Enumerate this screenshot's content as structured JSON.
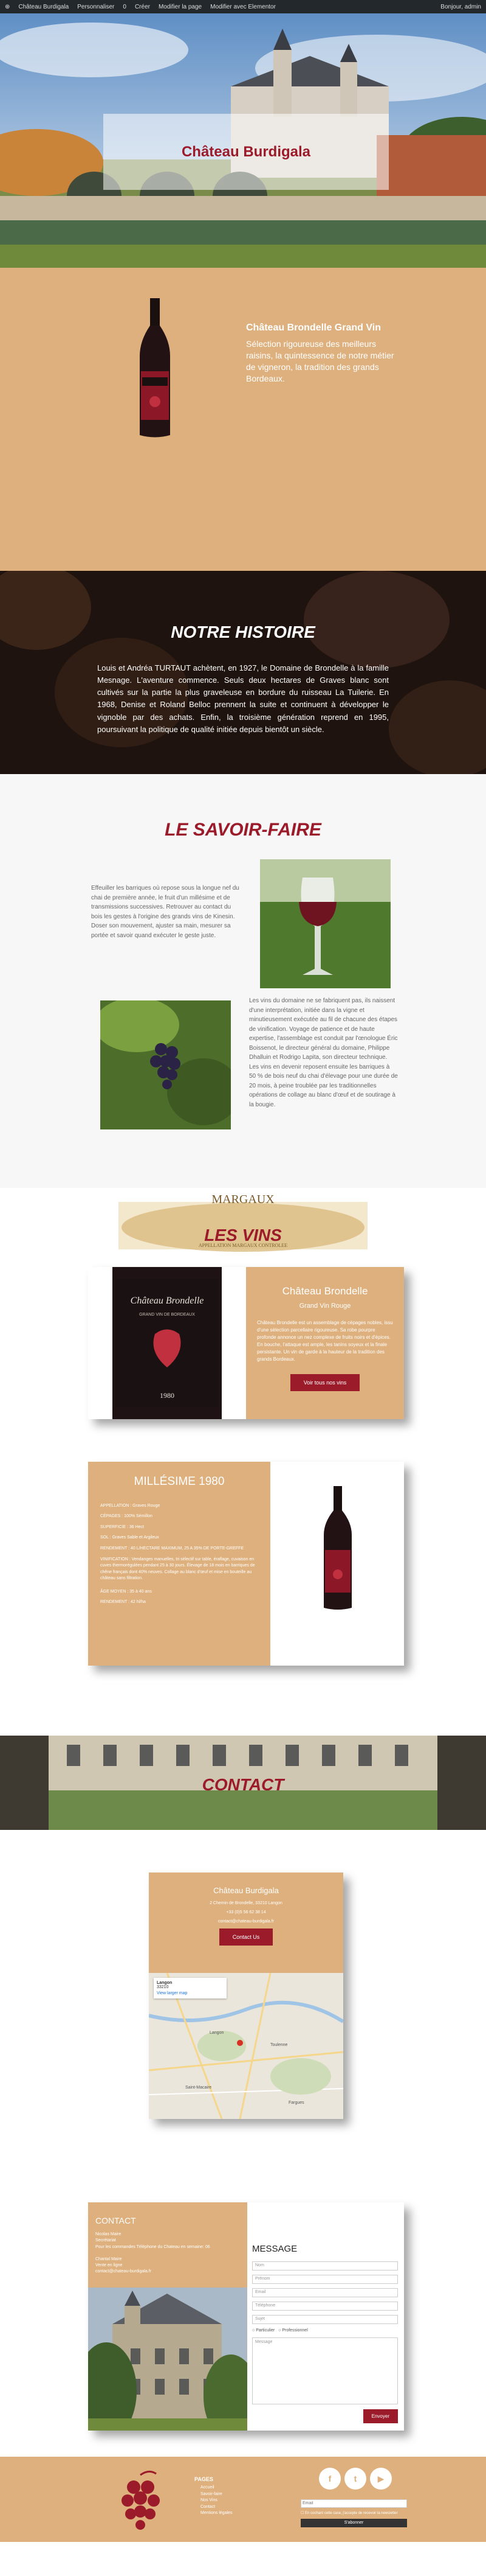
{
  "adminbar": {
    "site": "Château Burdigala",
    "customize": "Personnaliser",
    "comments": "0",
    "new": "Créer",
    "edit": "Modifier la page",
    "ninja": "Modifier avec Elementor",
    "user": "Bonjour, admin"
  },
  "hero": {
    "title": "Château Burdigala"
  },
  "grand_vin": {
    "title": "Château Brondelle Grand Vin",
    "text": "Sélection rigoureuse des meilleurs raisins, la quintessence de notre métier de vigneron, la tradition des grands Bordeaux."
  },
  "histoire": {
    "title": "NOTRE HISTOIRE",
    "text": "Louis et Andréa TURTAUT achètent, en 1927, le Domaine de Brondelle à la famille Mesnage. L'aventure commence. Seuls deux hectares de Graves blanc sont cultivés sur la partie la plus graveleuse en bordure du ruisseau La Tuilerie. En 1968, Denise et Roland Belloc prennent la suite et continuent à développer le vignoble par des achats. Enfin, la troisième génération reprend en 1995, poursuivant la politique de qualité initiée depuis bientôt un siècle."
  },
  "savoir": {
    "title": "LE SAVOIR-FAIRE",
    "p1": "Effeuiller les barriques où repose sous la longue nef du chai de première année, le fruit d'un millésime et de transmissions successives. Retrouver au contact du bois les gestes à l'origine des grands vins de Kinesin. Doser son mouvement, ajuster sa main, mesurer sa portée et savoir quand exécuter le geste juste.",
    "p2": "Les vins du domaine ne se fabriquent pas, ils naissent d'une interprétation, initiée dans la vigne et minutieusement exécutée au fil de chacune des étapes de vinification. Voyage de patience et de haute expertise, l'assemblage est conduit par l'œnologue Éric Boissenot, le directeur général du domaine, Philippe Dhalluin et Rodrigo Lapita, son directeur technique. Les vins en devenir reposent ensuite les barriques à 50 % de bois neuf du chai d'élevage pour une durée de 20 mois, à peine troublée par les traditionnelles opérations de collage au blanc d'œuf et de soutirage à la bougie."
  },
  "vins": {
    "title": "LES VINS",
    "logo_text": "MARGAUX",
    "logo_sub": "APPELLATION MARGAUX CONTROLEE"
  },
  "wine1": {
    "label_name": "Château Brondelle",
    "label_sub": "GRAND VIN DE BORDEAUX",
    "label_year": "1980",
    "title": "Château Brondelle",
    "sub": "Grand Vin Rouge",
    "desc": "Château Brondelle est un assemblage de cépages nobles, issu d'une sélection parcellaire rigoureuse. Sa robe pourpre profonde annonce un nez complexe de fruits noirs et d'épices. En bouche, l'attaque est ample, les tanins soyeux et la finale persistante. Un vin de garde à la hauteur de la tradition des grands Bordeaux.",
    "button": "Voir tous nos vins"
  },
  "wine2": {
    "title": "MILLÉSIME 1980",
    "lines": [
      "APPELLATION : Graves Rouge",
      "CÉPAGES : 100% Sémillon",
      "SUPERFICIE : 36 Hect",
      "SOL : Graves Sable et Argileux",
      "RENDEMENT : 40 L/HECTARE MAXIMUM, 25 A 35% DE PORTE-GREFFE"
    ],
    "long": "VINIFICATION : Vendanges manuelles, tri sélectif sur table, éraflage, cuvaison en cuves thermorégulées pendant 25 à 30 jours. Élevage de 18 mois en barriques de chêne français dont 40% neuves. Collage au blanc d'œuf et mise en bouteille au château sans filtration.",
    "age": "ÂGE MOYEN : 35 à 40 ans",
    "yield": "RENDEMENT : 42 hl/ha"
  },
  "contact": {
    "title": "CONTACT"
  },
  "address": {
    "title": "Château Burdigala",
    "line1": "2 Chemin de Brondelle, 33210 Langon",
    "phone": "+33 (0)5 56 62 38 14",
    "email": "contact@chateau-burdigala.fr",
    "button": "Contact Us",
    "map_place": "Langon",
    "map_sub": "33210",
    "map_link": "View larger map",
    "map_town2": "Toulenne",
    "map_town3": "Saint-Macaire",
    "map_town4": "Fargues"
  },
  "form_info": {
    "title": "CONTACT",
    "lines": [
      "Nicolas Maire",
      "Secrétariat",
      "Pour les commandes Téléphone du Chateau en semaine: 06",
      "",
      "Chantal Maire",
      "Vente en ligne",
      "contact@chateau-burdigala.fr"
    ]
  },
  "form": {
    "title": "MESSAGE",
    "name": "Nom",
    "firstname": "Prénom",
    "email": "Email",
    "phone": "Téléphone",
    "subject": "Sujet",
    "radio1": "Particulier",
    "radio2": "Professionnel",
    "message": "Message",
    "send": "Envoyer"
  },
  "footer": {
    "pages_title": "PAGES",
    "pages": [
      "Accueil",
      "Savoir-faire",
      "Nos Vins",
      "Contact",
      "Mentions légales"
    ],
    "newsletter_placeholder": "Email",
    "newsletter_consent": "En cochant cette case, j'accepte de recevoir la newsletter",
    "subscribe": "S'abonner"
  }
}
